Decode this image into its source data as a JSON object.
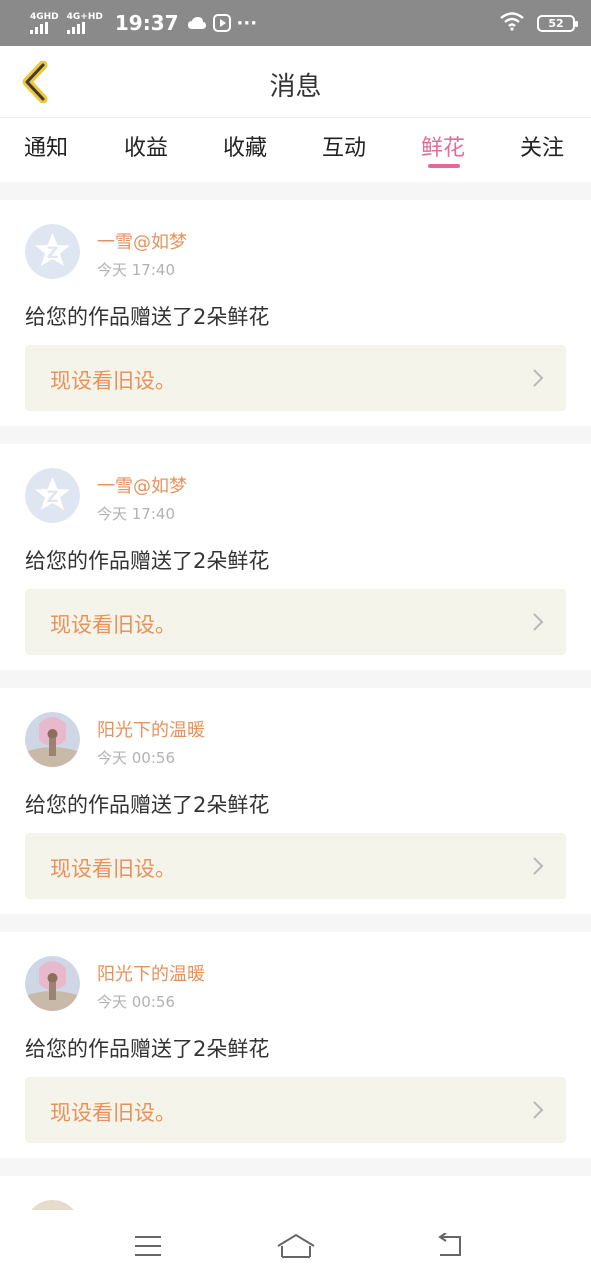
{
  "status_bar": {
    "signal1_label": "4GHD",
    "signal2_label": "4G+HD",
    "time": "19:37",
    "dots": "···",
    "battery": "52"
  },
  "header": {
    "title": "消息"
  },
  "tabs": [
    {
      "label": "通知",
      "active": false
    },
    {
      "label": "收益",
      "active": false
    },
    {
      "label": "收藏",
      "active": false
    },
    {
      "label": "互动",
      "active": false
    },
    {
      "label": "鲜花",
      "active": true
    },
    {
      "label": "关注",
      "active": false
    }
  ],
  "messages": [
    {
      "name": "一雪@如梦",
      "time": "今天 17:40",
      "text": "给您的作品赠送了2朵鲜花",
      "work_title": "现设看旧设。",
      "avatar": "default-avatar-icon"
    },
    {
      "name": "一雪@如梦",
      "time": "今天 17:40",
      "text": "给您的作品赠送了2朵鲜花",
      "work_title": "现设看旧设。",
      "avatar": "default-avatar-icon"
    },
    {
      "name": "阳光下的温暖",
      "time": "今天 00:56",
      "text": "给您的作品赠送了2朵鲜花",
      "work_title": "现设看旧设。",
      "avatar": "photo-avatar"
    },
    {
      "name": "阳光下的温暖",
      "time": "今天 00:56",
      "text": "给您的作品赠送了2朵鲜花",
      "work_title": "现设看旧设。",
      "avatar": "photo-avatar"
    }
  ],
  "colors": {
    "accent_pink": "#e36b9b",
    "name_orange": "#e8925a",
    "quote_bg": "#f5f4ea"
  },
  "nav": {
    "menu_icon": "menu-icon",
    "home_icon": "home-icon",
    "back_icon": "back-icon"
  }
}
